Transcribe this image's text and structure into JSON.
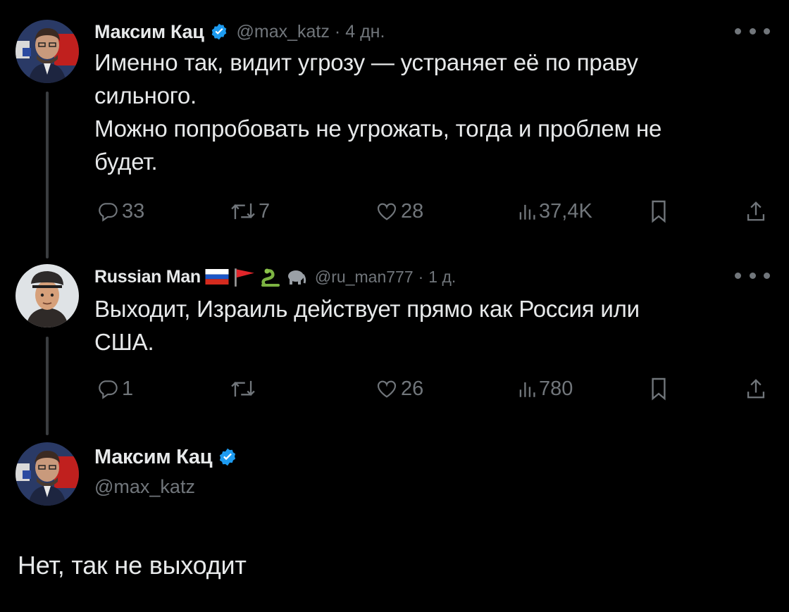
{
  "tweets": [
    {
      "display_name": "Максим Кац",
      "handle": "@max_katz",
      "separator": "·",
      "time": "4 дн.",
      "text_lines": [
        "Именно так, видит угрозу — устраняет её по праву",
        "сильного.",
        "Можно попробовать не угрожать, тогда и проблем не",
        "будет."
      ],
      "replies": "33",
      "reposts": "7",
      "likes": "28",
      "views": "37,4K"
    },
    {
      "display_name": "Russian Man",
      "name_emojis": [
        "russia-flag-icon",
        "red-flag-icon",
        "snake-icon",
        "elephant-icon"
      ],
      "handle": "@ru_man777",
      "separator": "·",
      "time": "1 д.",
      "text_lines": [
        "Выходит, Израиль действует прямо как Россия или",
        "США."
      ],
      "replies": "1",
      "reposts": "",
      "likes": "26",
      "views": "780"
    }
  ],
  "main_tweet": {
    "display_name": "Максим Кац",
    "handle": "@max_katz",
    "text": "Нет, так не выходит"
  },
  "colors": {
    "background": "#000000",
    "text": "#e7e9ea",
    "muted": "#71767b",
    "verified": "#1d9bf0",
    "thread_line": "#3a3d40"
  }
}
